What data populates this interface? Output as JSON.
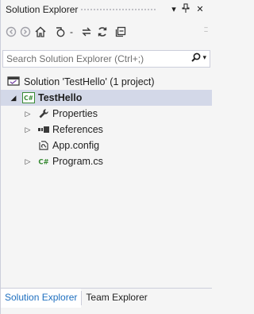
{
  "window": {
    "title": "Solution Explorer",
    "controls": {
      "dropdown": "▾",
      "pin": "⊥",
      "close": "✕"
    }
  },
  "toolbar": {
    "items": [
      {
        "name": "back-icon"
      },
      {
        "name": "forward-icon"
      },
      {
        "name": "home-icon"
      },
      {
        "name": "history-icon"
      },
      {
        "name": "dropdown-icon",
        "label": "-"
      },
      {
        "name": "sync-icon"
      },
      {
        "name": "refresh-icon"
      },
      {
        "name": "collapse-all-icon"
      }
    ]
  },
  "search": {
    "placeholder": "Search Solution Explorer (Ctrl+;)",
    "value": ""
  },
  "tree": {
    "solution": "Solution 'TestHello' (1 project)",
    "project": "TestHello",
    "project_badge": "C#",
    "items": [
      {
        "label": "Properties",
        "expandable": true
      },
      {
        "label": "References",
        "expandable": true
      },
      {
        "label": "App.config",
        "expandable": false
      },
      {
        "label": "Program.cs",
        "expandable": true,
        "badge": "C#"
      }
    ]
  },
  "tabs": [
    {
      "label": "Solution Explorer",
      "active": true
    },
    {
      "label": "Team Explorer",
      "active": false
    }
  ],
  "colors": {
    "accent": "#1e6fbf",
    "selection": "#d3d8e8",
    "csharp_green": "#388a34"
  }
}
